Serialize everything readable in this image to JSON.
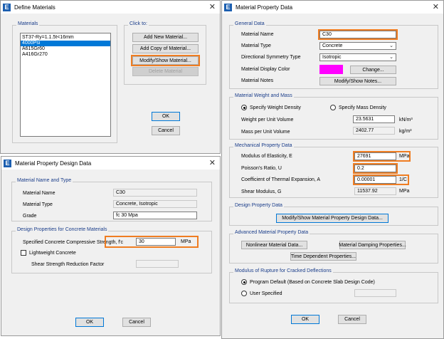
{
  "define_materials": {
    "title": "Define Materials",
    "materials_group": "Materials",
    "materials": [
      "ST37-Ry=1.1.5t<16mm",
      "4000Psi",
      "A615Gr60",
      "A416Gr270"
    ],
    "selected_index": 1,
    "click_to_group": "Click to:",
    "add_new": "Add New Material...",
    "add_copy": "Add Copy of Material...",
    "modify_show": "Modify/Show Material...",
    "delete": "Delete Material",
    "ok": "OK",
    "cancel": "Cancel"
  },
  "material_property": {
    "title": "Material Property Data",
    "general_group": "General Data",
    "name_label": "Material Name",
    "name_value": "C30",
    "type_label": "Material Type",
    "type_value": "Concrete",
    "symmetry_label": "Directional Symmetry Type",
    "symmetry_value": "Isotropic",
    "color_label": "Material Display Color",
    "color_button": "Change...",
    "notes_label": "Material Notes",
    "notes_button": "Modify/Show Notes...",
    "weight_group": "Material Weight and Mass",
    "specify_weight": "Specify Weight Density",
    "specify_mass": "Specify Mass Density",
    "weight_label": "Weight per Unit Volume",
    "weight_value": "23.5631",
    "weight_unit": "kN/m³",
    "mass_label": "Mass per Unit Volume",
    "mass_value": "2402.77",
    "mass_unit": "kg/m³",
    "mech_group": "Mechanical Property Data",
    "e_label": "Modulus of Elasticity,  E",
    "e_value": "27691",
    "e_unit": "MPa",
    "u_label": "Poisson's Ratio,  U",
    "u_value": "0.2",
    "a_label": "Coefficient of Thermal Expansion,  A",
    "a_value": "0.00001",
    "a_unit": "1/C",
    "g_label": "Shear Modulus,  G",
    "g_value": "11537.92",
    "g_unit": "MPa",
    "design_group": "Design Property Data",
    "design_button": "Modify/Show Material Property Design Data...",
    "adv_group": "Advanced Material Property Data",
    "nonlinear_button": "Nonlinear Material Data...",
    "damping_button": "Material Damping Properties...",
    "time_button": "Time Dependent Properties...",
    "rupture_group": "Modulus of Rupture for Cracked Deflections",
    "program_default": "Program Default  (Based on Concrete Slab Design Code)",
    "user_specified": "User Specified",
    "ok": "OK",
    "cancel": "Cancel",
    "display_color": "#ff00ff"
  },
  "design_data": {
    "title": "Material Property Design Data",
    "name_type_group": "Material Name and Type",
    "name_label": "Material Name",
    "name_value": "C30",
    "type_label": "Material Type",
    "type_value": "Concrete, Isotropic",
    "grade_label": "Grade",
    "grade_value": "fc 30 Mpa",
    "props_group": "Design Properties for Concrete Materials",
    "fc_label": "Specified Concrete Compressive Strength, f'c",
    "fc_value": "30",
    "fc_unit": "MPa",
    "lightweight": "Lightweight Concrete",
    "shear_label": "Shear Strength Reduction Factor",
    "ok": "OK",
    "cancel": "Cancel"
  },
  "colors": {
    "highlight": "#ef7d22",
    "group_title": "#1a3d8a",
    "selection": "#0078d7"
  }
}
